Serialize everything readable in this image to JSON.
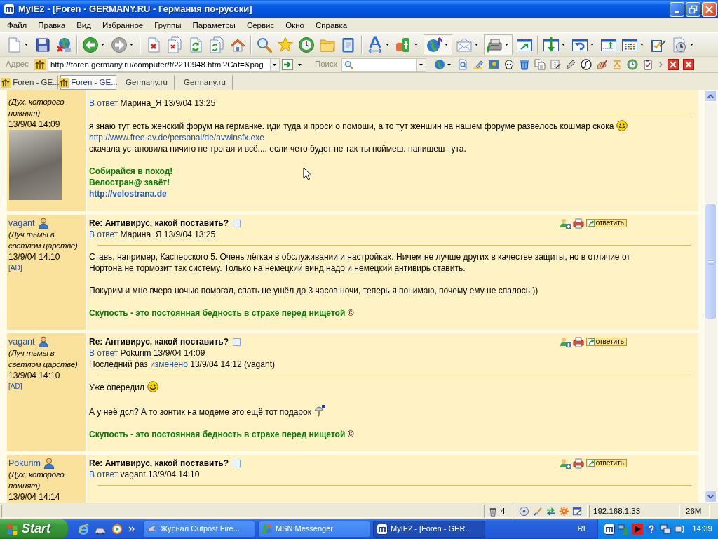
{
  "window": {
    "title": "MyIE2 - [Foren - GERMANY.RU - Германия по-русски]"
  },
  "menu": [
    "Файл",
    "Правка",
    "Вид",
    "Избранное",
    "Группы",
    "Параметры",
    "Сервис",
    "Окно",
    "Справка"
  ],
  "address_bar": {
    "label": "Адрес",
    "url": "http://foren.germany.ru/computer/f/2210948.html?Cat=&pag",
    "search_label": "Поиск"
  },
  "tabs": [
    {
      "label": "Foren - GE...",
      "kind": "site",
      "selected": false
    },
    {
      "label": "Foren - GE...",
      "kind": "site",
      "selected": true
    },
    {
      "label": "Germany.ru",
      "kind": "plain",
      "selected": false
    },
    {
      "label": "Germany.ru",
      "kind": "plain",
      "selected": false
    }
  ],
  "posts": [
    {
      "status": "(Дух, которого помнят)",
      "date": "13/9/04 14:09",
      "photo": true,
      "reply_link": "В ответ",
      "reply_to": "Марина_Я 13/9/04 13:25",
      "body": [
        [
          {
            "kind": "text",
            "text": "я знаю тут есть женский форум на германке. иди туда и проси о помоши, а то тут женшин на нашем форуме развелось кошмар скока",
            "emoticon": {
              "kind": "smile"
            }
          },
          {
            "kind": "link",
            "text": "http://www.free-av.de/personal/de/avwinsfx.exe"
          },
          {
            "kind": "text",
            "text": "скачала установила ничиго не трогая и всё.... если чето будет не так ты поймеш. напишеш тута."
          }
        ]
      ],
      "signature": [
        {
          "kind": "text",
          "text": "Собирайся в поход!"
        },
        {
          "kind": "text",
          "text": "Велостран@ завёт!"
        },
        {
          "kind": "link",
          "text": "http://velostrana.de"
        }
      ]
    },
    {
      "author": "vagant",
      "status": "(Луч тьмы в светлом царстве)",
      "date": "13/9/04 14:10",
      "ad": "[AD]",
      "title": "Re: Антивирус, какой поставить?",
      "reply_button": "ответить",
      "reply_link": "В ответ",
      "reply_to": "Марина_Я 13/9/04 13:25",
      "body": [
        [
          {
            "kind": "text",
            "text": "Ставь, например, Касперского 5. Очень лёгкая в обслуживании и настройках. Ничем не лучше других в качестве защиты, но в отличие от Нортона не тормозит так систему. Только на немецкий винд надо и немецкий антивирь ставить."
          }
        ],
        [
          {
            "kind": "text",
            "text": "Покурим и мне вчера ночью помогал, спать не ушёл до 3 часов ночи, теперь я понимаю, почему ему не спалось ))"
          }
        ]
      ],
      "signature": [
        {
          "kind": "text",
          "text": "Скупость - это постоянная бедность в страхе перед нищетой",
          "mark": "©"
        }
      ]
    },
    {
      "author": "vagant",
      "status": "(Луч тьмы в светлом царстве)",
      "date": "13/9/04 14:10",
      "ad": "[AD]",
      "title": "Re: Антивирус, какой поставить?",
      "reply_button": "ответить",
      "reply_link": "В ответ",
      "reply_to": "Pokurim 13/9/04 14:09",
      "edited": {
        "prefix": "Последний раз",
        "link": "изменено",
        "suffix": "13/9/04 14:12 (vagant)"
      },
      "body": [
        [
          {
            "kind": "text",
            "text": "Уже опередил",
            "emoticon": {
              "kind": "smile"
            }
          }
        ],
        [
          {
            "kind": "text",
            "text": "А у неё дсл? А то зонтик на модеме это ещё тот подарок",
            "emoticon": {
              "kind": "gadget"
            }
          }
        ]
      ],
      "signature": [
        {
          "kind": "text",
          "text": "Скупость - это постоянная бедность в страхе перед нищетой",
          "mark": "©"
        }
      ]
    },
    {
      "author": "Pokurim",
      "status": "(Дух, которого помнят)",
      "date": "13/9/04 14:14",
      "title": "Re: Антивирус, какой поставить?",
      "reply_button": "ответить",
      "reply_link": "В ответ",
      "reply_to": "vagant 13/9/04 14:10"
    }
  ],
  "status_bar": {
    "trash_count": "4",
    "ip": "192.168.1.33",
    "memory": "26M"
  },
  "taskbar": {
    "start": "Start",
    "tasks": [
      {
        "label": "Журнал Outpost Fire...",
        "kind": "firewall",
        "selected": false
      },
      {
        "label": "MSN Messenger",
        "kind": "messenger",
        "selected": false
      },
      {
        "label": "MyIE2 - [Foren - GER...",
        "kind": "browser",
        "selected": true
      }
    ],
    "tray_text": "RL",
    "clock": "14:39"
  }
}
